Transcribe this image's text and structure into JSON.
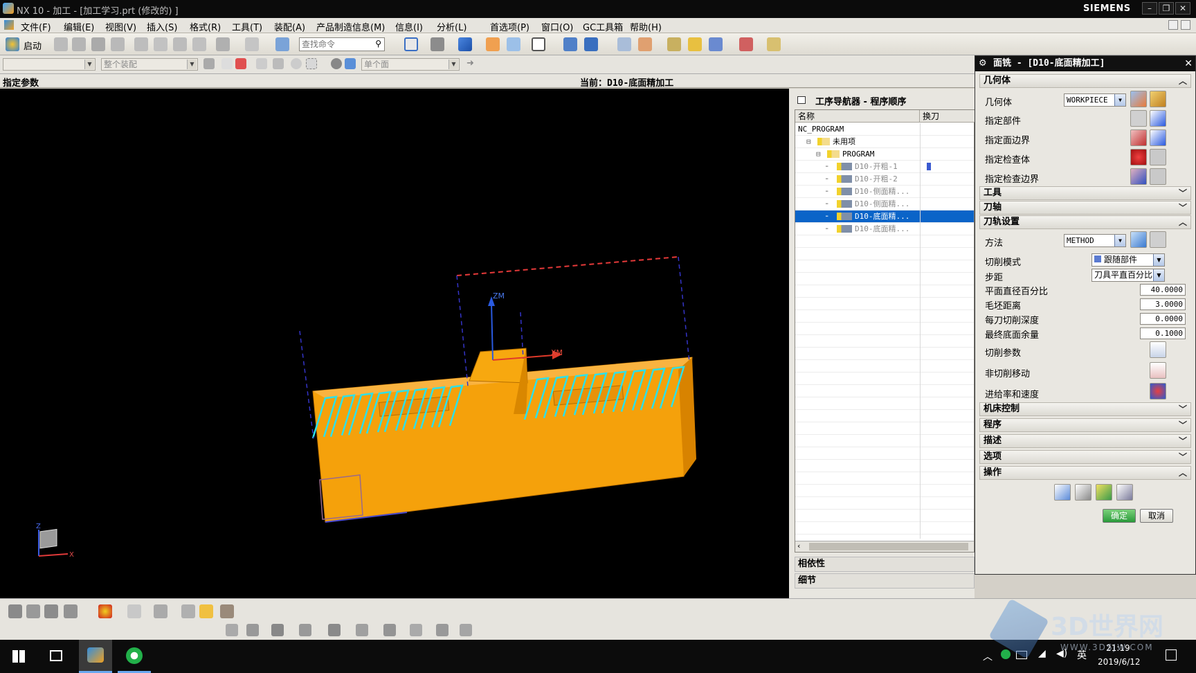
{
  "window": {
    "title": "NX 10 - 加工 - [加工学习.prt  (修改的) ]",
    "brand": "SIEMENS"
  },
  "menu": [
    "文件(F)",
    "编辑(E)",
    "视图(V)",
    "插入(S)",
    "格式(R)",
    "工具(T)",
    "装配(A)",
    "产品制造信息(M)",
    "信息(I)",
    "分析(L)",
    "首选项(P)",
    "窗口(O)",
    "GC工具箱",
    "帮助(H)"
  ],
  "toolbar": {
    "start_label": "启动",
    "search_placeholder": "查找命令"
  },
  "selection_bar": {
    "filter_scope": "整个装配",
    "face_rule": "单个面"
  },
  "status": {
    "left": "指定参数",
    "current": "当前：D10-底面精加工"
  },
  "viewport": {
    "zm_label": "ZM",
    "xm_label": "XM",
    "triad_z": "Z",
    "triad_x": "X",
    "part_color": "#f7a00b",
    "toolpath_color": "#2ee0e8"
  },
  "navigator": {
    "title": "工序导航器 - 程序顺序",
    "columns": [
      "名称",
      "换刀"
    ],
    "rows": [
      {
        "label": "NC_PROGRAM",
        "level": 0,
        "type": "root"
      },
      {
        "label": "未用项",
        "level": 1,
        "type": "folder"
      },
      {
        "label": "PROGRAM",
        "level": 2,
        "type": "folder"
      },
      {
        "label": "D10-开粗-1",
        "level": 3,
        "type": "op",
        "tool_change": true
      },
      {
        "label": "D10-开粗-2",
        "level": 3,
        "type": "op"
      },
      {
        "label": "D10-侧面精...",
        "level": 3,
        "type": "op"
      },
      {
        "label": "D10-侧面精...",
        "level": 3,
        "type": "op"
      },
      {
        "label": "D10-底面精...",
        "level": 3,
        "type": "op",
        "selected": true
      },
      {
        "label": "D10-底面精...",
        "level": 3,
        "type": "op"
      }
    ],
    "dependencies": "相依性",
    "details": "细节"
  },
  "dialog": {
    "title": "面铣 - [D10-底面精加工]",
    "geometry": {
      "section": "几何体",
      "geometry_label": "几何体",
      "geometry_value": "WORKPIECE",
      "part": "指定部件",
      "face_boundary": "指定面边界",
      "check_body": "指定检查体",
      "check_boundary": "指定检查边界"
    },
    "tool": "工具",
    "axis": "刀轴",
    "path_settings": {
      "section": "刀轨设置",
      "method_label": "方法",
      "method_value": "METHOD",
      "cut_pattern_label": "切削模式",
      "cut_pattern_value": "跟随部件",
      "stepover_label": "步距",
      "stepover_value": "刀具平直百分比",
      "flat_pct_label": "平面直径百分比",
      "flat_pct_value": "40.0000",
      "blank_dist_label": "毛坯距离",
      "blank_dist_value": "3.0000",
      "depth_label": "每刀切削深度",
      "depth_value": "0.0000",
      "floor_stock_label": "最终底面余量",
      "floor_stock_value": "0.1000",
      "cut_params": "切削参数",
      "non_cut": "非切削移动",
      "feeds": "进给率和速度"
    },
    "machine": "机床控制",
    "program": "程序",
    "description": "描述",
    "options": "选项",
    "actions": "操作",
    "ok": "确定",
    "cancel": "取消"
  },
  "taskbar": {
    "time": "21:19",
    "date": "2019/6/12",
    "ime": "英"
  },
  "watermark": {
    "text": "3D世界网",
    "url": "WWW.3DSJW.COM"
  }
}
